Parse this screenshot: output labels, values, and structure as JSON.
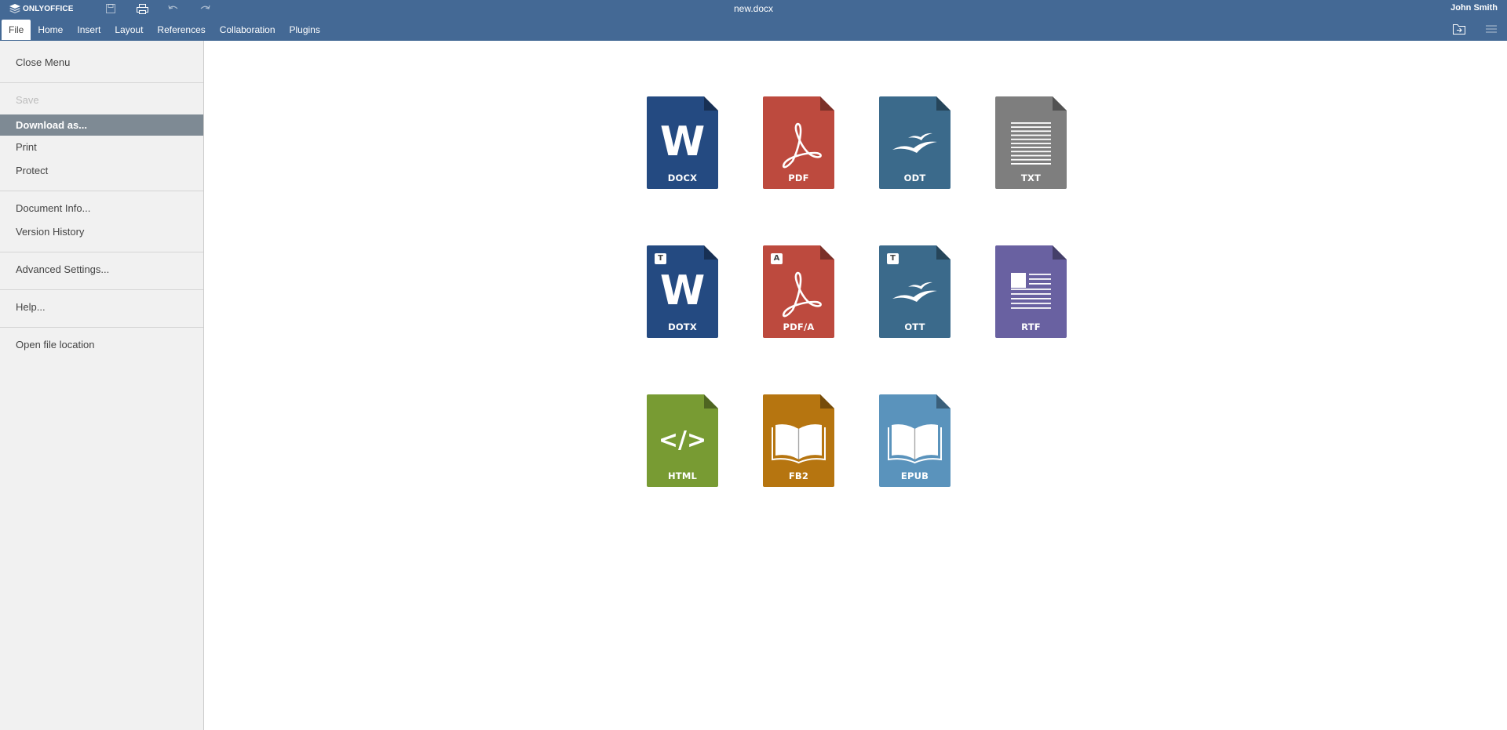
{
  "header": {
    "brand": "ONLYOFFICE",
    "document_title": "new.docx",
    "user_name": "John Smith",
    "quick_access": [
      "save-icon",
      "print-icon",
      "undo-icon",
      "redo-icon"
    ]
  },
  "tabs": [
    {
      "label": "File",
      "active": true
    },
    {
      "label": "Home"
    },
    {
      "label": "Insert"
    },
    {
      "label": "Layout"
    },
    {
      "label": "References"
    },
    {
      "label": "Collaboration"
    },
    {
      "label": "Plugins"
    }
  ],
  "file_menu": {
    "close": "Close Menu",
    "save": "Save",
    "download_as": "Download as...",
    "print": "Print",
    "protect": "Protect",
    "document_info": "Document Info...",
    "version_history": "Version History",
    "advanced_settings": "Advanced Settings...",
    "help": "Help...",
    "open_location": "Open file location"
  },
  "formats": [
    {
      "label": "DOCX",
      "color": "#244a81",
      "icon": "word-icon"
    },
    {
      "label": "PDF",
      "color": "#bd4a3e",
      "icon": "acrobat-icon"
    },
    {
      "label": "ODT",
      "color": "#3b6a8b",
      "icon": "seagull-icon"
    },
    {
      "label": "TXT",
      "color": "#7e7e7e",
      "icon": "text-lines-icon"
    },
    {
      "label": "DOTX",
      "color": "#244a81",
      "icon": "word-icon",
      "badge": "T"
    },
    {
      "label": "PDF/A",
      "color": "#bd4a3e",
      "icon": "acrobat-icon",
      "badge": "A"
    },
    {
      "label": "OTT",
      "color": "#3b6a8b",
      "icon": "seagull-icon",
      "badge": "T"
    },
    {
      "label": "RTF",
      "color": "#6961a1",
      "icon": "rich-text-icon"
    },
    {
      "label": "HTML",
      "color": "#789b33",
      "icon": "code-icon"
    },
    {
      "label": "FB2",
      "color": "#b67510",
      "icon": "book-icon"
    },
    {
      "label": "EPUB",
      "color": "#5a93bc",
      "icon": "book-icon"
    }
  ]
}
